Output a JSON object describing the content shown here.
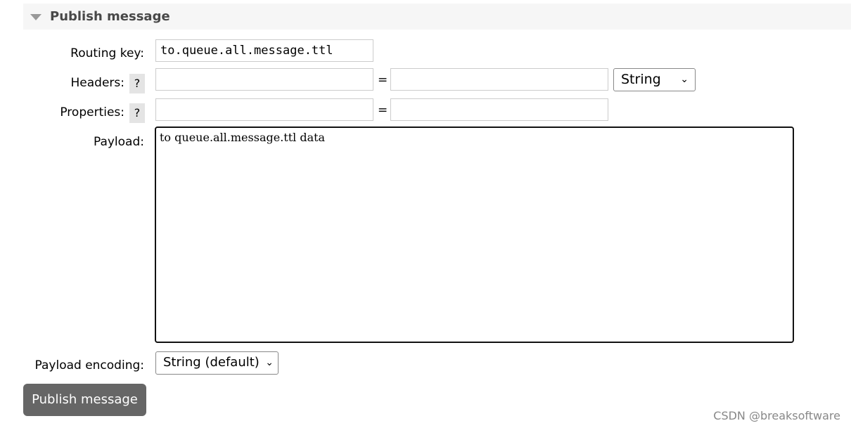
{
  "section": {
    "title": "Publish message",
    "icon": "triangle-down-icon"
  },
  "form": {
    "routing_key": {
      "label": "Routing key:",
      "value": "to.queue.all.message.ttl"
    },
    "headers": {
      "label": "Headers:",
      "help": "?",
      "key": "",
      "value": "",
      "equals": "=",
      "type": "String"
    },
    "properties": {
      "label": "Properties:",
      "help": "?",
      "key": "",
      "value": "",
      "equals": "="
    },
    "payload": {
      "label": "Payload:",
      "value": "to queue.all.message.ttl data"
    },
    "payload_encoding": {
      "label": "Payload encoding:",
      "value": "String (default)"
    }
  },
  "publish_button": "Publish message",
  "watermark": "CSDN @breaksoftware"
}
